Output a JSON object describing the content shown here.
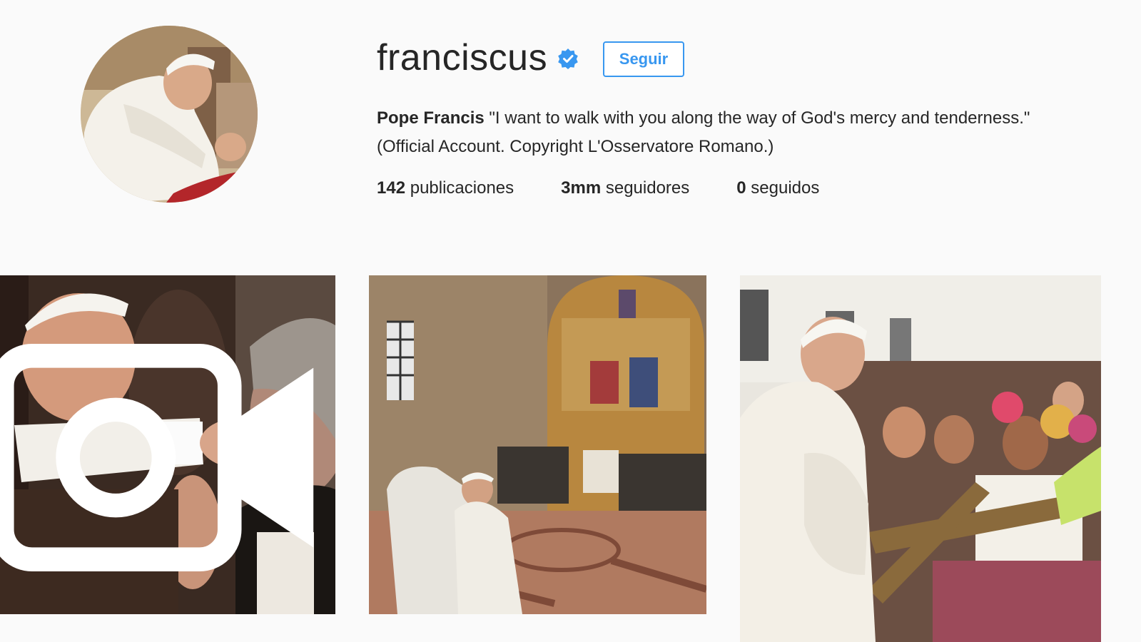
{
  "profile": {
    "username": "franciscus",
    "verified": true,
    "follow_label": "Seguir",
    "bio_name": "Pope Francis",
    "bio_text": " \"I want to walk with you along the way of God's mercy and tenderness.\" (Official Account. Copyright L'Osservatore Romano.)",
    "stats": {
      "posts_count": "142",
      "posts_label": " publicaciones",
      "followers_count": "3mm",
      "followers_label": " seguidores",
      "following_count": "0",
      "following_label": " seguidos"
    }
  },
  "posts": [
    {
      "type": "video",
      "icon": "video-camera-icon"
    },
    {
      "type": "photo"
    },
    {
      "type": "photo"
    }
  ],
  "colors": {
    "background": "#fafafa",
    "accent": "#3897f0",
    "text": "#262626"
  }
}
